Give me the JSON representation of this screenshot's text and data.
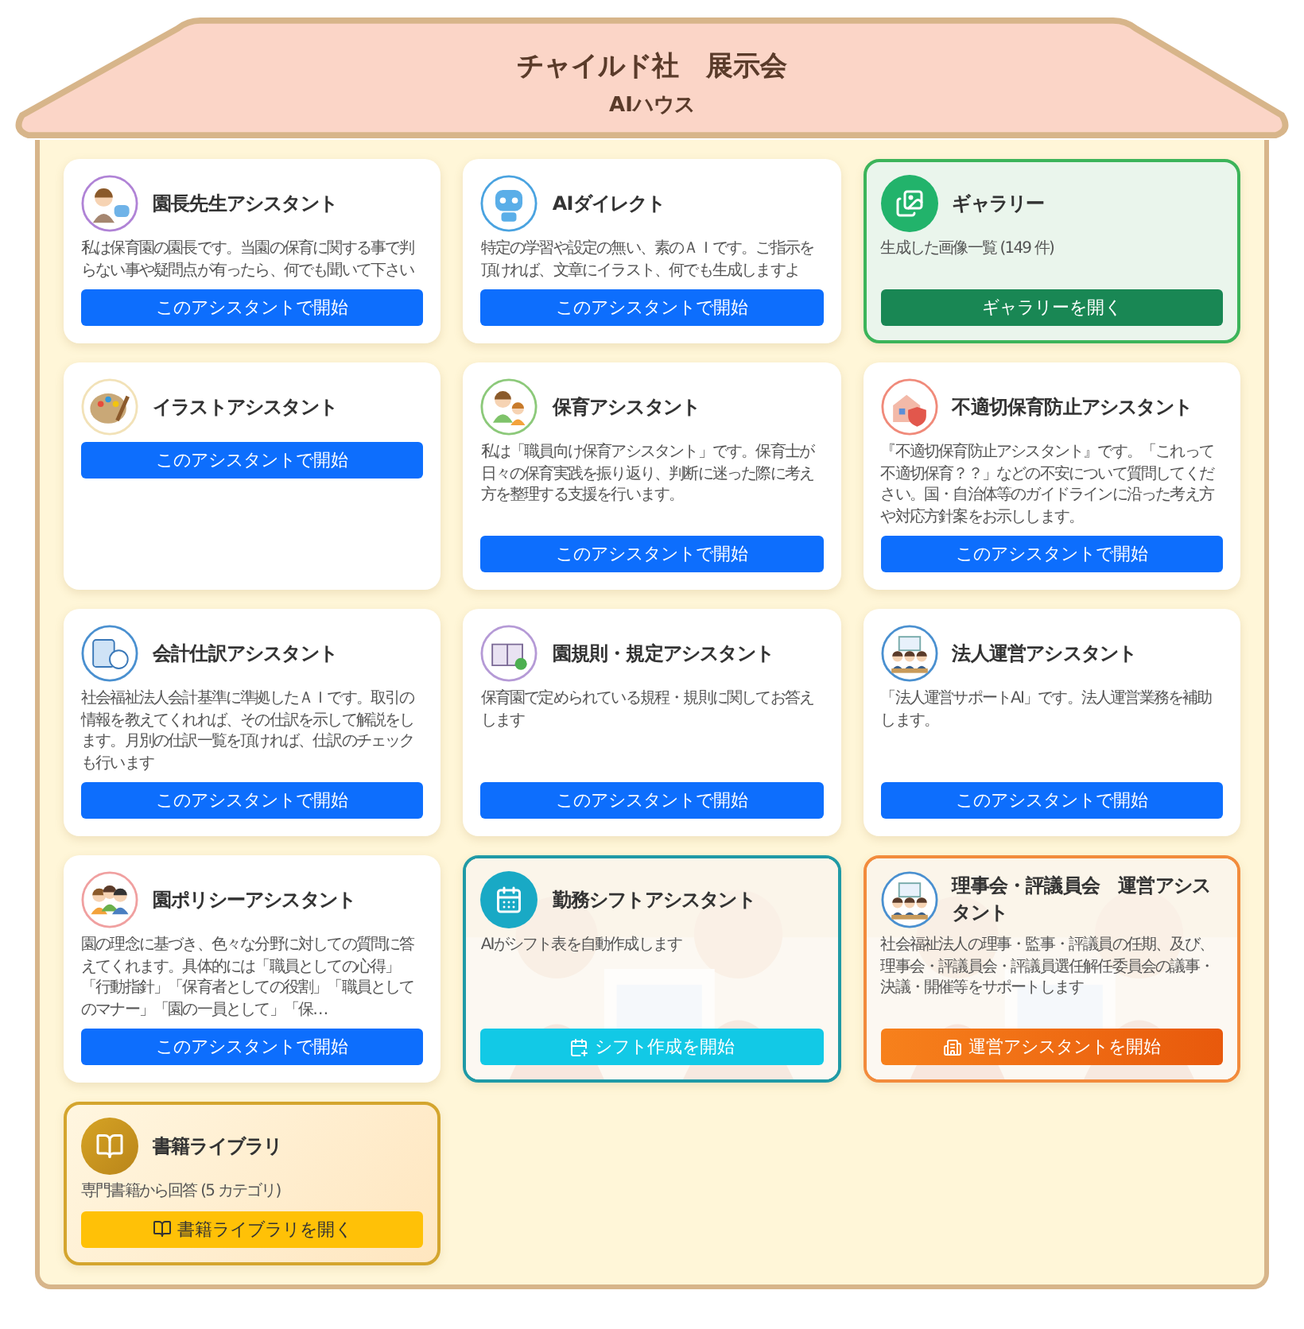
{
  "header": {
    "title": "チャイルド社　展示会",
    "subtitle": "AIハウス"
  },
  "cards": [
    {
      "kind": "assistant",
      "title": "園長先生アシスタント",
      "description": "私は保育園の園長です。当園の保育に関する事で判らない事や疑問点が有ったら、何でも聞いて下さい",
      "button": {
        "label": "このアシスタントで開始"
      }
    },
    {
      "kind": "assistant",
      "title": "AIダイレクト",
      "description": "特定の学習や設定の無い、素のＡＩです。ご指示を頂ければ、文章にイラスト、何でも生成しますよ",
      "button": {
        "label": "このアシスタントで開始"
      }
    },
    {
      "kind": "gallery",
      "title": "ギャラリー",
      "description": "生成した画像一覧 (149 件)",
      "button": {
        "label": "ギャラリーを開く"
      }
    },
    {
      "kind": "assistant",
      "title": "イラストアシスタント",
      "button": {
        "label": "このアシスタントで開始"
      }
    },
    {
      "kind": "assistant",
      "title": "保育アシスタント",
      "description": "私は「職員向け保育アシスタント」です。保育士が日々の保育実践を振り返り、判断に迷った際に考え方を整理する支援を行います。",
      "button": {
        "label": "このアシスタントで開始"
      }
    },
    {
      "kind": "assistant",
      "title": "不適切保育防止アシスタント",
      "description": "『不適切保育防止アシスタント』です。「これって不適切保育？？」などの不安について質問してください。国・自治体等のガイドラインに沿った考え方や対応方針案をお示しします。",
      "button": {
        "label": "このアシスタントで開始"
      }
    },
    {
      "kind": "assistant",
      "title": "会計仕訳アシスタント",
      "description": "社会福祉法人会計基準に準拠したＡＩです。取引の情報を教えてくれれば、その仕訳を示して解説をします。月別の仕訳一覧を頂ければ、仕訳のチェックも行います",
      "button": {
        "label": "このアシスタントで開始"
      }
    },
    {
      "kind": "assistant",
      "title": "園規則・規定アシスタント",
      "description": "保育園で定められている規程・規則に関してお答えします",
      "button": {
        "label": "このアシスタントで開始"
      }
    },
    {
      "kind": "assistant",
      "title": "法人運営アシスタント",
      "description": "「法人運営サポートAI」です。法人運営業務を補助します。",
      "button": {
        "label": "このアシスタントで開始"
      }
    },
    {
      "kind": "assistant",
      "title": "園ポリシーアシスタント",
      "description": "園の理念に基づき、色々な分野に対しての質問に答えてくれます。具体的には「職員としての心得」「行動指針」「保育者としての役割」「職員としてのマナー」「園の一員として」「保…",
      "button": {
        "label": "このアシスタントで開始"
      }
    },
    {
      "kind": "shift",
      "title": "勤務シフトアシスタント",
      "description": "AIがシフト表を自動作成します",
      "button": {
        "label": "シフト作成を開始"
      }
    },
    {
      "kind": "board",
      "title": "理事会・評議員会　運営アシスタント",
      "description": "社会福祉法人の理事・監事・評議員の任期、及び、理事会・評議員会・評議員選任解任委員会の議事・決議・開催等をサポートします",
      "button": {
        "label": "運営アシスタントを開始"
      }
    },
    {
      "kind": "library",
      "title": "書籍ライブラリ",
      "description": "専門書籍から回答 (5 カテゴリ)",
      "button": {
        "label": "書籍ライブラリを開く"
      }
    }
  ]
}
